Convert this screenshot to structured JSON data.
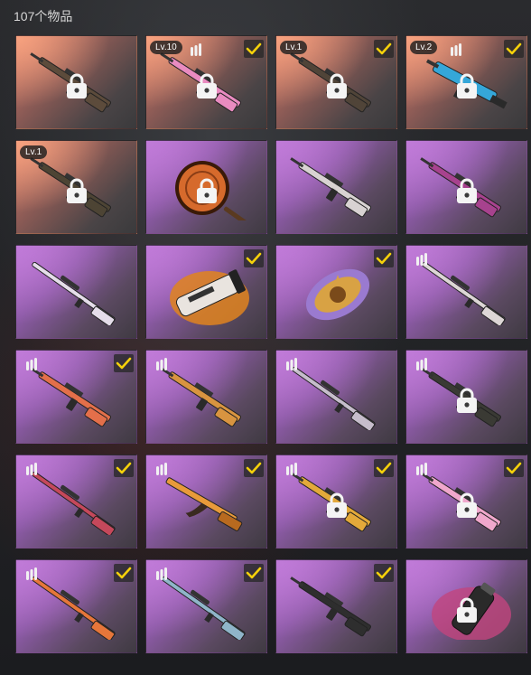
{
  "header": {
    "count_text": "107个物品"
  },
  "colors": {
    "rare": "#d97e6b",
    "epic": "#b774cf",
    "check": "#f5d10a"
  },
  "items": [
    {
      "rarity": "red",
      "weapon": "rifle",
      "skin": "#5c4b3b",
      "level": "",
      "ammo": false,
      "locked": true,
      "checked": false
    },
    {
      "rarity": "red",
      "weapon": "rifle",
      "skin": "#e98bc0",
      "level": "Lv.10",
      "ammo": true,
      "locked": true,
      "checked": true
    },
    {
      "rarity": "red",
      "weapon": "rifle",
      "skin": "#504438",
      "level": "Lv.1",
      "ammo": false,
      "locked": true,
      "checked": true
    },
    {
      "rarity": "red",
      "weapon": "smg",
      "skin": "#35a7d9",
      "level": "Lv.2",
      "ammo": true,
      "locked": true,
      "checked": true
    },
    {
      "rarity": "red",
      "weapon": "rifle",
      "skin": "#4d4434",
      "level": "Lv.1",
      "ammo": false,
      "locked": true,
      "checked": false
    },
    {
      "rarity": "purple",
      "weapon": "pan",
      "skin": "#d66a2c",
      "level": "",
      "ammo": false,
      "locked": true,
      "checked": false
    },
    {
      "rarity": "purple",
      "weapon": "rifle",
      "skin": "#d8d2d2",
      "level": "",
      "ammo": false,
      "locked": false,
      "checked": false
    },
    {
      "rarity": "purple",
      "weapon": "rifle",
      "skin": "#a7428e",
      "level": "",
      "ammo": false,
      "locked": true,
      "checked": false
    },
    {
      "rarity": "purple",
      "weapon": "sniper",
      "skin": "#e5ddea",
      "level": "",
      "ammo": false,
      "locked": false,
      "checked": false
    },
    {
      "rarity": "purple",
      "weapon": "launcher",
      "skin": "#e9e4df",
      "level": "",
      "ammo": false,
      "locked": false,
      "checked": true
    },
    {
      "rarity": "purple",
      "weapon": "emblem",
      "skin": "#d8a244",
      "level": "",
      "ammo": false,
      "locked": false,
      "checked": true
    },
    {
      "rarity": "purple",
      "weapon": "sniper",
      "skin": "#ddd6d6",
      "level": "",
      "ammo": true,
      "locked": false,
      "checked": false
    },
    {
      "rarity": "purple",
      "weapon": "rifle",
      "skin": "#e36f4a",
      "level": "",
      "ammo": true,
      "locked": false,
      "checked": true
    },
    {
      "rarity": "purple",
      "weapon": "rifle",
      "skin": "#d89440",
      "level": "",
      "ammo": true,
      "locked": false,
      "checked": false
    },
    {
      "rarity": "purple",
      "weapon": "sniper",
      "skin": "#c6bdcb",
      "level": "",
      "ammo": true,
      "locked": false,
      "checked": false
    },
    {
      "rarity": "purple",
      "weapon": "rifle",
      "skin": "#3a3a34",
      "level": "",
      "ammo": true,
      "locked": true,
      "checked": false
    },
    {
      "rarity": "purple",
      "weapon": "sniper",
      "skin": "#c5485b",
      "level": "",
      "ammo": true,
      "locked": false,
      "checked": true
    },
    {
      "rarity": "purple",
      "weapon": "ak",
      "skin": "#e89a3a",
      "level": "",
      "ammo": true,
      "locked": false,
      "checked": true
    },
    {
      "rarity": "purple",
      "weapon": "rifle",
      "skin": "#e3a93a",
      "level": "",
      "ammo": true,
      "locked": true,
      "checked": true
    },
    {
      "rarity": "purple",
      "weapon": "rifle",
      "skin": "#f0a7cc",
      "level": "",
      "ammo": true,
      "locked": true,
      "checked": true
    },
    {
      "rarity": "purple",
      "weapon": "sniper",
      "skin": "#e6763a",
      "level": "",
      "ammo": true,
      "locked": false,
      "checked": true
    },
    {
      "rarity": "purple",
      "weapon": "sniper",
      "skin": "#8fb5c9",
      "level": "",
      "ammo": true,
      "locked": false,
      "checked": true
    },
    {
      "rarity": "purple",
      "weapon": "rifle",
      "skin": "#2e2e2e",
      "level": "",
      "ammo": false,
      "locked": false,
      "checked": true
    },
    {
      "rarity": "purple",
      "weapon": "grenade",
      "skin": "#2a2a2a",
      "level": "",
      "ammo": false,
      "locked": true,
      "checked": false
    }
  ]
}
